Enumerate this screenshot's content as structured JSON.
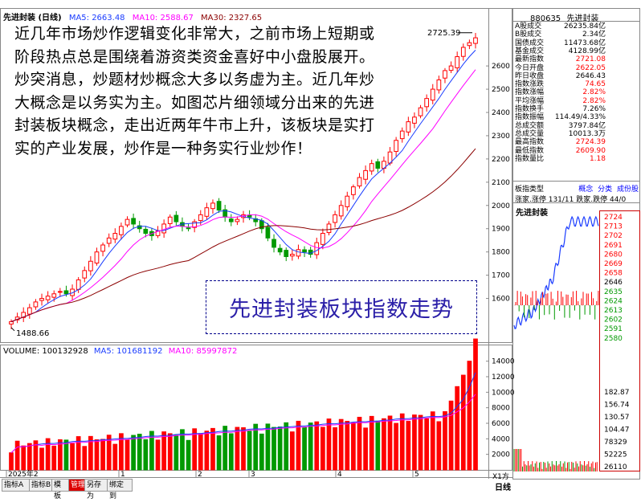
{
  "header": {
    "title": "先进封装 (日线)",
    "ma5": "MA5: 2663.48",
    "ma10": "MA10: 2588.67",
    "ma30": "MA30: 2327.65"
  },
  "right_panel": {
    "code": "880635",
    "name": "先进封装",
    "rows": [
      {
        "label": "A股成交",
        "value": "26235.84亿",
        "color": "#000000"
      },
      {
        "label": "B股成交",
        "value": "2.34亿",
        "color": "#000000"
      },
      {
        "label": "国债成交",
        "value": "11473.68亿",
        "color": "#000000"
      },
      {
        "label": "基金成交",
        "value": "4128.99亿",
        "color": "#000000"
      },
      {
        "label": "最新指数",
        "value": "2721.08",
        "color": "#ff0000"
      },
      {
        "label": "今日开盘",
        "value": "2622.05",
        "color": "#ff0000"
      },
      {
        "label": "昨日收盘",
        "value": "2646.43",
        "color": "#000000"
      },
      {
        "label": "指数涨跌",
        "value": "74.65",
        "color": "#ff0000"
      },
      {
        "label": "指数涨幅",
        "value": "2.82%",
        "color": "#ff0000"
      },
      {
        "label": "平均涨幅",
        "value": "2.82%",
        "color": "#ff0000"
      },
      {
        "label": "指数换手",
        "value": "7.26%",
        "color": "#000000"
      },
      {
        "label": "指数振幅",
        "value": "114.49/4.33%",
        "color": "#000000"
      },
      {
        "label": "总成交额",
        "value": "3797.84亿",
        "color": "#000000"
      },
      {
        "label": "总成交量",
        "value": "10013.3万",
        "color": "#000000"
      },
      {
        "label": "最高指数",
        "value": "2724.39",
        "color": "#ff0000"
      },
      {
        "label": "最低指数",
        "value": "2609.90",
        "color": "#ff0000"
      },
      {
        "label": "指数量比",
        "value": "1.18",
        "color": "#ff0000"
      }
    ],
    "board_type_label": "板指类型",
    "board_links": [
      "概念",
      "分类",
      "成份股"
    ],
    "adv_dec": "涨家.涨停 131/11 跌家.跌停 44/0",
    "mini_title": "先进封装",
    "mini_price_labels": [
      "2724",
      "2713",
      "2702",
      "2691",
      "2680",
      "2669",
      "2658",
      "2646",
      "2635",
      "2624",
      "2613",
      "2602",
      "2591",
      "2580"
    ],
    "mini_vol_labels": [
      "182.87",
      "156.74",
      "130.57",
      "104.47",
      "78329",
      "52225",
      "26110"
    ],
    "bottom_tabs": [
      "日线",
      "X1方"
    ]
  },
  "price_axis": [
    "2600",
    "2500",
    "2400",
    "2300",
    "2200",
    "2100",
    "2000",
    "1900",
    "1800",
    "1700",
    "1600"
  ],
  "volume": {
    "label": "VOLUME: 100132928",
    "ma5": "MA5: 101681192",
    "ma10": "MA10: 85997872",
    "axis": [
      "14000",
      "12000",
      "10000",
      "8000",
      "6000",
      "4000",
      "2000"
    ],
    "unit": "X1方"
  },
  "date_axis": [
    "2025年2",
    "1",
    "2",
    "3",
    "4",
    "5"
  ],
  "status_bar": [
    "指标A",
    "指标B",
    "模 板",
    "管理",
    "另存为",
    "绑定到"
  ],
  "essay": "近几年市场炒作逻辑变化非常大，之前市场上短期或阶段热点总是围绕着游资类资金喜好中小盘股展开。炒突消息，炒题材炒概念大多以务虚为主。近几年炒大概念是以务实为主。如图芯片细领域分出来的先进封装板块概念，走出近两年牛市上升，该板块是实打实的产业发展，炒作是一种务实行业炒作！",
  "caption": "先进封装板块指数走势",
  "colors": {
    "up": "#ff0000",
    "down": "#009900",
    "ma5": "#1a3cff",
    "ma10": "#ff00ff",
    "ma30": "#8b0000"
  },
  "chart_data": {
    "type": "candlestick",
    "title": "先进封装 (日线)",
    "annotations": [
      {
        "label": "2725.39",
        "type": "high"
      },
      {
        "label": "1488.66",
        "type": "low"
      }
    ],
    "ylim": [
      1450,
      2780
    ],
    "series": [
      {
        "name": "先进封装",
        "close_approx": [
          1500,
          1520,
          1540,
          1560,
          1585,
          1600,
          1610,
          1620,
          1630,
          1620,
          1640,
          1680,
          1720,
          1760,
          1800,
          1830,
          1860,
          1880,
          1910,
          1940,
          1920,
          1900,
          1880,
          1870,
          1890,
          1920,
          1950,
          1930,
          1910,
          1900,
          1930,
          1960,
          1990,
          2010,
          1980,
          1950,
          1930,
          1940,
          1960,
          1950,
          1930,
          1900,
          1860,
          1820,
          1800,
          1780,
          1790,
          1810,
          1800,
          1790,
          1840,
          1880,
          1920,
          1960,
          2000,
          2040,
          2080,
          2120,
          2150,
          2180,
          2160,
          2190,
          2230,
          2280,
          2320,
          2360,
          2380,
          2420,
          2460,
          2500,
          2540,
          2580,
          2600,
          2640,
          2680,
          2700,
          2721
        ]
      }
    ]
  }
}
